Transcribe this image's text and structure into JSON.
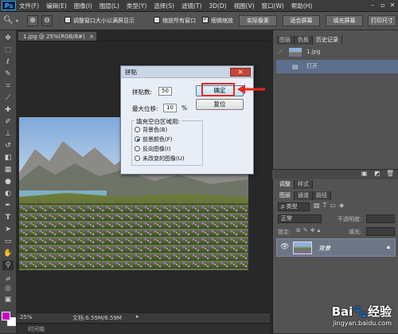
{
  "app": {
    "logo": "Ps"
  },
  "menu": [
    "文件(F)",
    "编辑(E)",
    "图像(I)",
    "图层(L)",
    "类型(Y)",
    "选择(S)",
    "滤镜(T)",
    "3D(D)",
    "视图(V)",
    "窗口(W)",
    "帮助(H)"
  ],
  "window_controls": [
    "minimize-icon",
    "restore-icon",
    "close-icon"
  ],
  "options_bar": {
    "resize_windows": "调整窗口大小以满屏显示",
    "resize_windows_checked": false,
    "zoom_all": "缩放所有窗口",
    "zoom_all_checked": false,
    "scrubby_zoom": "细微缩放",
    "scrubby_zoom_checked": true,
    "actual_pixels": "实际像素",
    "fit_screen": "适合屏幕",
    "fill_screen": "填充屏幕",
    "print_size": "打印尺寸"
  },
  "document": {
    "tab_title": "1.jpg @ 25%(RGB/8#)"
  },
  "status": {
    "zoom": "25%",
    "doc_size": "文档:6.59M/6.59M"
  },
  "timeline_label": "时间轴",
  "panels": {
    "top_tabs": [
      "图层",
      "色板",
      "历史记录"
    ],
    "history_snapshot": "1.jpg",
    "history_step": "打开",
    "mid_tabs": [
      "调整",
      "样式"
    ],
    "layer_tabs": [
      "图层",
      "通道",
      "路径"
    ],
    "filter_kind": "ρ 类型",
    "blend_mode": "正常",
    "opacity_label": "不透明度:",
    "lock_label": "锁定:",
    "fill_label": "填充:",
    "layer_name": "背景"
  },
  "dialog": {
    "title": "拼贴",
    "tile_count_label": "拼贴数:",
    "tile_count_value": "50",
    "max_offset_label": "最大位移:",
    "max_offset_value": "10",
    "max_offset_unit": "%",
    "fill_group_label": "填充空白区域用:",
    "fill_options": [
      "背景色(B)",
      "前景颜色(F)",
      "反向图像(I)",
      "未改变的图像(U)"
    ],
    "selected_fill_option": 1,
    "ok": "确定",
    "reset": "复位"
  },
  "colors": {
    "foreground": "#c800c8",
    "background": "#ffffff",
    "annotation_red": "#e8251e"
  },
  "watermark": {
    "brand": "Bai🐾经验",
    "url": "jingyan.baidu.com"
  }
}
